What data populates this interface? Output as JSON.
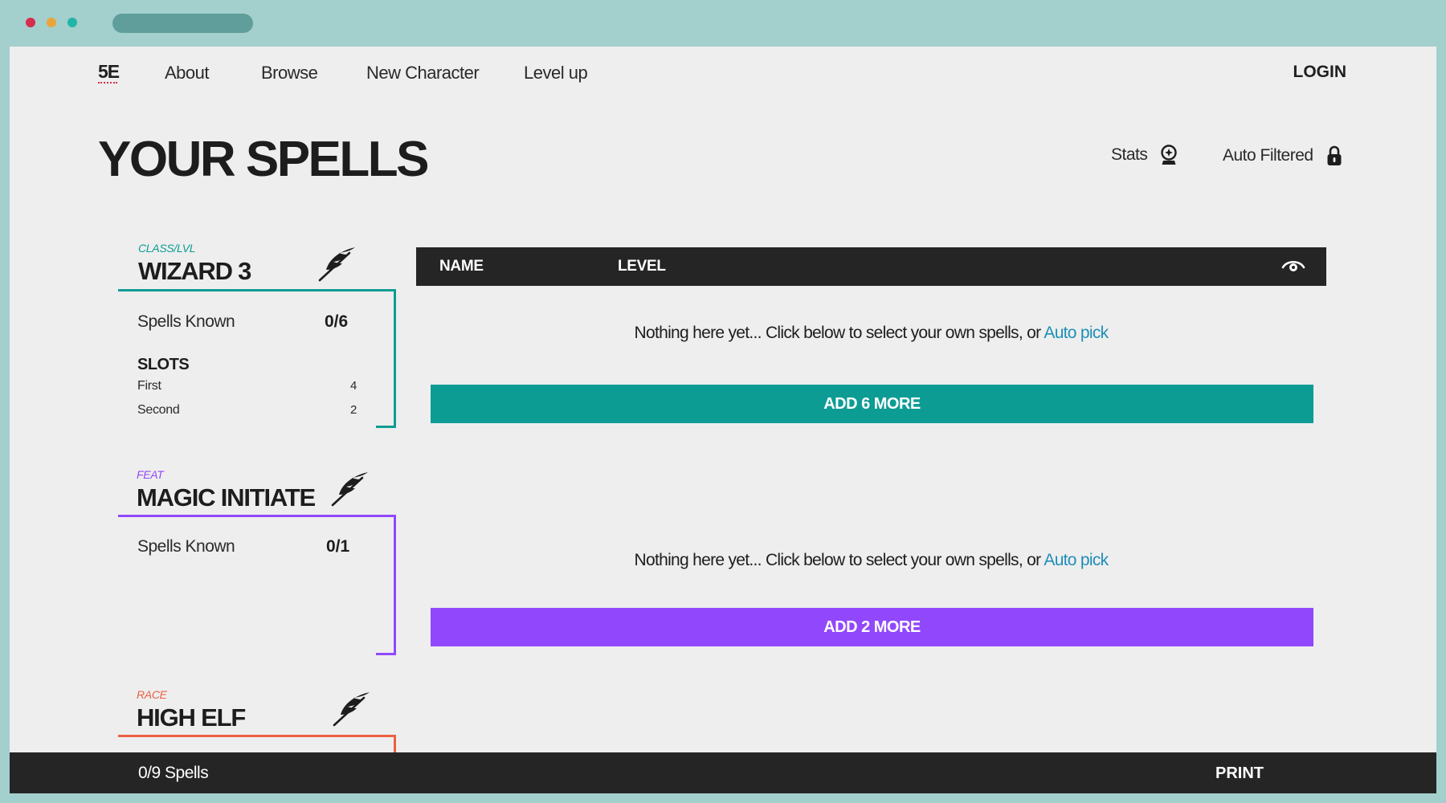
{
  "window": {
    "dot_colors": [
      "#d62d4b",
      "#e9a53a",
      "#1fb5a8"
    ]
  },
  "nav": {
    "logo": "5E",
    "items": [
      "About",
      "Browse",
      "New Character",
      "Level up"
    ],
    "login": "LOGIN"
  },
  "page_title": "YOUR SPELLS",
  "tools": {
    "stats": "Stats",
    "auto_filtered": "Auto Filtered"
  },
  "table": {
    "col_name": "NAME",
    "col_level": "LEVEL"
  },
  "empty": {
    "text": "Nothing here yet... Click below to select your own spells, or ",
    "link": "Auto pick"
  },
  "groups": [
    {
      "tag": "CLASS/LVL",
      "name": "WIZARD 3",
      "color": "#0c9c94",
      "spells_known_label": "Spells Known",
      "spells_known": "0/6",
      "slots_title": "SLOTS",
      "slots": [
        {
          "name": "First",
          "count": "4"
        },
        {
          "name": "Second",
          "count": "2"
        }
      ],
      "add_label": "ADD 6 MORE"
    },
    {
      "tag": "FEAT",
      "name": "MAGIC INITIATE",
      "color": "#9148fc",
      "spells_known_label": "Spells Known",
      "spells_known": "0/1",
      "add_label": "ADD 2 MORE"
    },
    {
      "tag": "RACE",
      "name": "HIGH ELF",
      "color": "#ec5f43"
    }
  ],
  "footer": {
    "count": "0/9 Spells",
    "print": "PRINT"
  }
}
